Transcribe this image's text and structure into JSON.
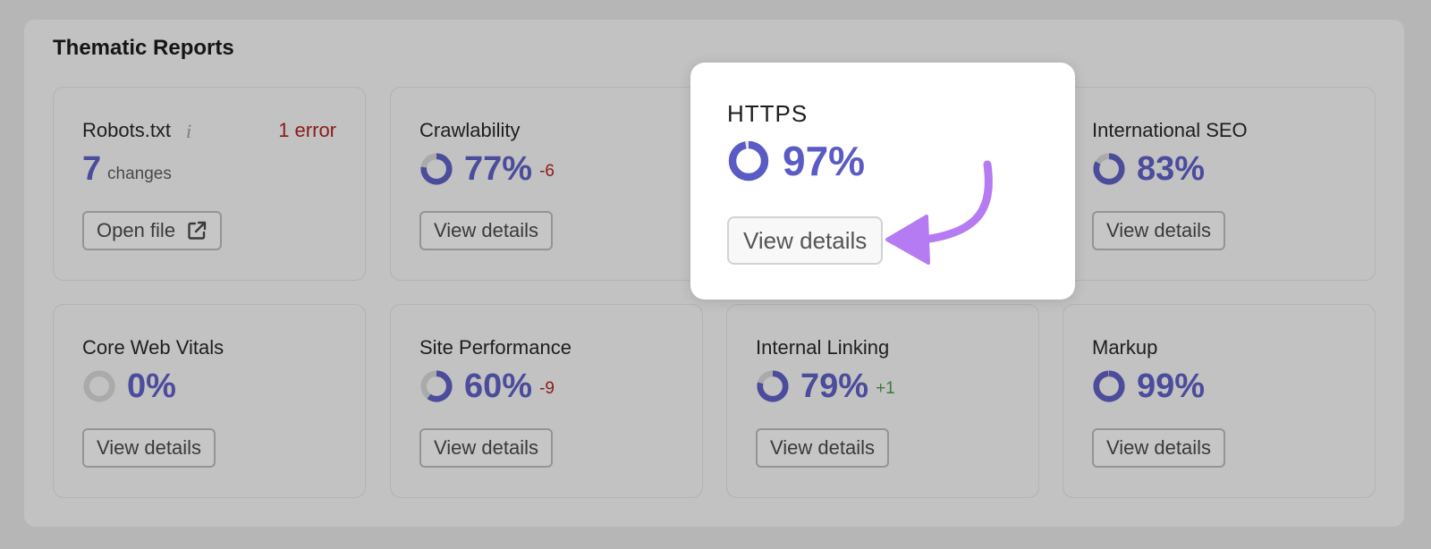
{
  "panel": {
    "title": "Thematic Reports"
  },
  "colors": {
    "accent": "#4b4c9c",
    "accent_highlight": "#5a5bc4",
    "ring_track": "#aaaaaa",
    "error": "#8c1a1a",
    "positive": "#3c7a3c",
    "arrow": "#b57bf2"
  },
  "cards": {
    "robots": {
      "label": "Robots.txt",
      "info_icon": "info-icon",
      "error": "1 error",
      "value": "7",
      "unit": "changes",
      "button": "Open file",
      "button_icon": "external-link-icon"
    },
    "crawlability": {
      "label": "Crawlability",
      "score": "77%",
      "score_fraction": 0.77,
      "delta": "-6",
      "button": "View details"
    },
    "international_seo": {
      "label": "International SEO",
      "score": "83%",
      "score_fraction": 0.83,
      "button": "View details"
    },
    "core_web_vitals": {
      "label": "Core Web Vitals",
      "score": "0%",
      "score_fraction": 0.0,
      "button": "View details"
    },
    "site_performance": {
      "label": "Site Performance",
      "score": "60%",
      "score_fraction": 0.6,
      "delta": "-9",
      "button": "View details"
    },
    "internal_linking": {
      "label": "Internal Linking",
      "score": "79%",
      "score_fraction": 0.79,
      "delta": "+1",
      "button": "View details"
    },
    "markup": {
      "label": "Markup",
      "score": "99%",
      "score_fraction": 0.99,
      "button": "View details"
    }
  },
  "highlight": {
    "label": "HTTPS",
    "score": "97%",
    "score_fraction": 0.97,
    "button": "View details",
    "pointer_icon": "curved-arrow-icon"
  }
}
